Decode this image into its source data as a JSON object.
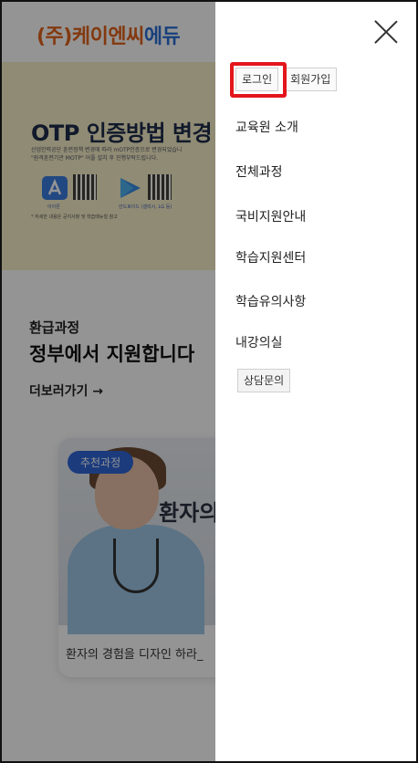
{
  "page": {
    "logo_part1": "(주)케이엔씨",
    "logo_part2": "에듀",
    "banner": {
      "title": "OTP 인증방법 변경",
      "desc_line1": "산업인력공단 훈련정책 변경에 따라 mOTP인증으로 변경되었습니",
      "desc_line2": "\"원격훈련기관 MOTP\" 어플 설치 후 진행부탁드립니다.",
      "app_store_caption": "아이폰",
      "play_store_caption": "안드로이드 (갤럭시, LG 등)",
      "note": "* 자세한 내용은 공지사항 및 학습매뉴얼 참고"
    },
    "course_kind": "환급과정",
    "course_head": "정부에서 지원합니다",
    "more_link": "더보러가기  →",
    "card": {
      "badge": "추천과정",
      "hero_text": "환자의",
      "caption": "환자의 경험을 디자인 하라_"
    }
  },
  "menu": {
    "login_label": "로그인",
    "signup_label": "회원가입",
    "items": [
      "교육원 소개",
      "전체과정",
      "국비지원안내",
      "학습지원센터",
      "학습유의사항",
      "내강의실"
    ],
    "consult_label": "상담문의"
  },
  "colors": {
    "logo_orange": "#e2621b",
    "logo_blue": "#2a6fd6",
    "highlight_red": "#e3161c",
    "badge_blue": "#2f66d8"
  },
  "icons": [
    "close-icon",
    "app-store-icon",
    "play-store-icon",
    "qr-code-icon"
  ]
}
